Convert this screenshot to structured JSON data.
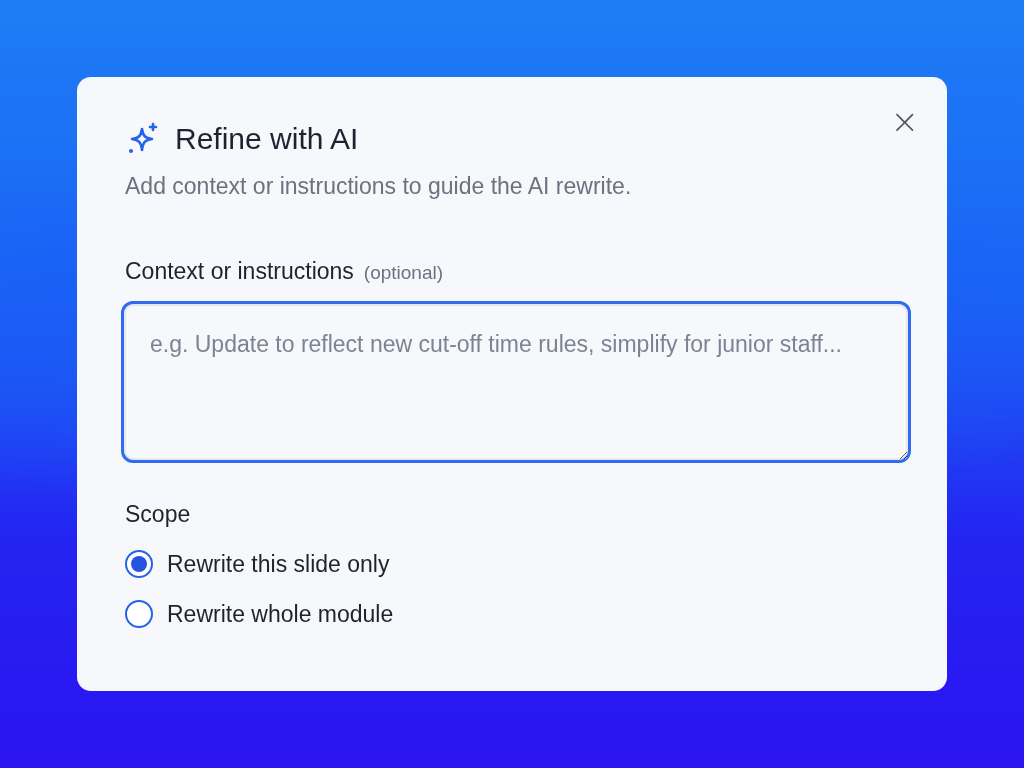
{
  "dialog": {
    "title": "Refine with AI",
    "close": "×",
    "description": "Add context or instructions to guide the AI rewrite.",
    "field": {
      "label": "Context or instructions",
      "hint": "(optional)",
      "placeholder": "e.g. Update to reflect new cut-off time rules, simplify for junior staff...",
      "focused": true
    },
    "scope": {
      "label": "Scope",
      "options": [
        {
          "label": "Rewrite this slide only",
          "selected": true
        },
        {
          "label": "Rewrite whole module",
          "selected": false
        }
      ]
    }
  }
}
